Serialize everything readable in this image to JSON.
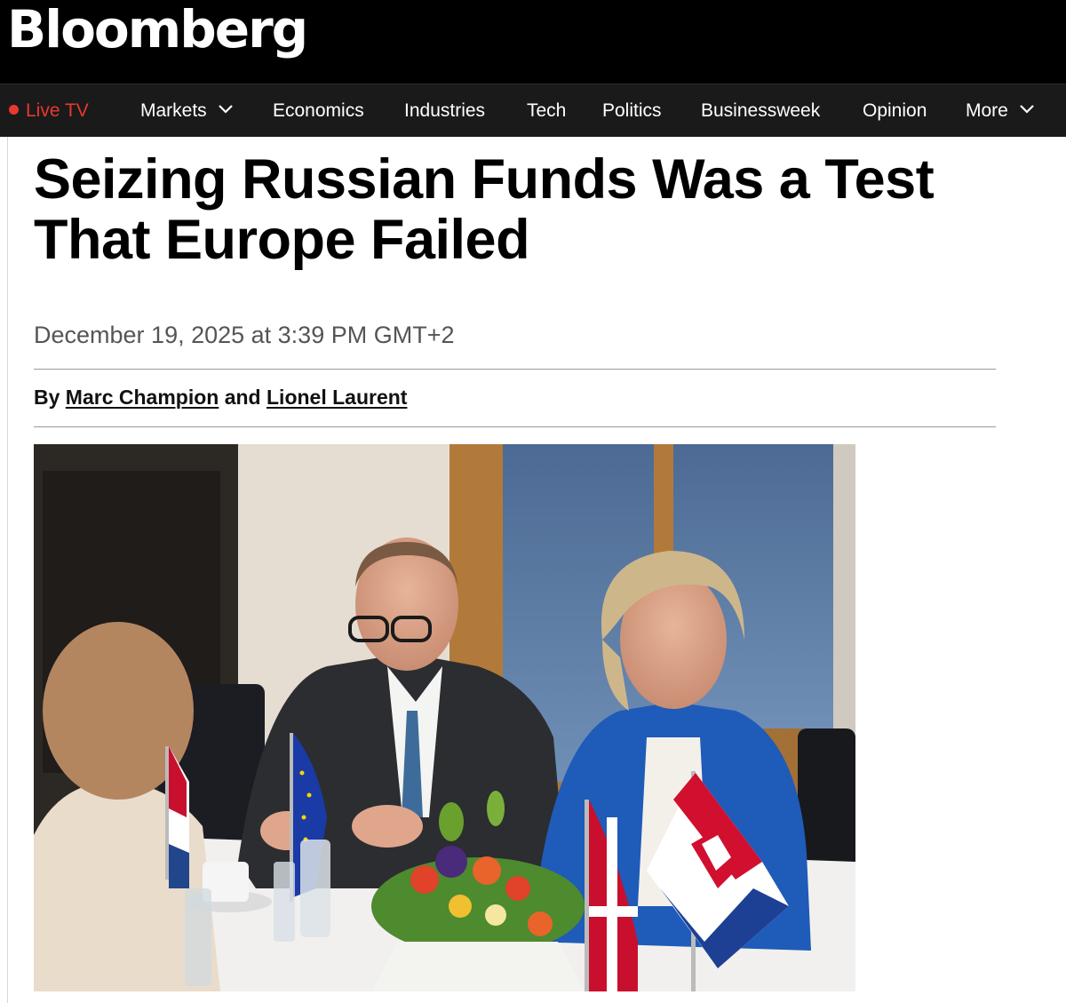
{
  "brand": {
    "logo_text": "Bloomberg"
  },
  "nav": {
    "live_tv": "Live TV",
    "items": [
      "Markets",
      "Economics",
      "Industries",
      "Tech",
      "Politics",
      "Businessweek",
      "Opinion",
      "More"
    ],
    "dropdown_items": [
      "Markets",
      "More"
    ]
  },
  "article": {
    "headline_line1": "Seizing Russian Funds Was a Test",
    "headline_line2": "That Europe Failed",
    "date": "December 19, 2025 at 3:39 PM GMT+2",
    "byline_prefix": "By",
    "author1": "Marc Champion",
    "byline_and": "and",
    "author2": "Lionel Laurent"
  },
  "colors": {
    "topbar": "#000000",
    "navbar": "#1a1a1a",
    "live_accent": "#e8382f",
    "date_text": "#555555",
    "rule": "#9a9a9a"
  },
  "icons": {
    "dropdown": "chevron-down-icon",
    "live": "live-dot-icon"
  }
}
